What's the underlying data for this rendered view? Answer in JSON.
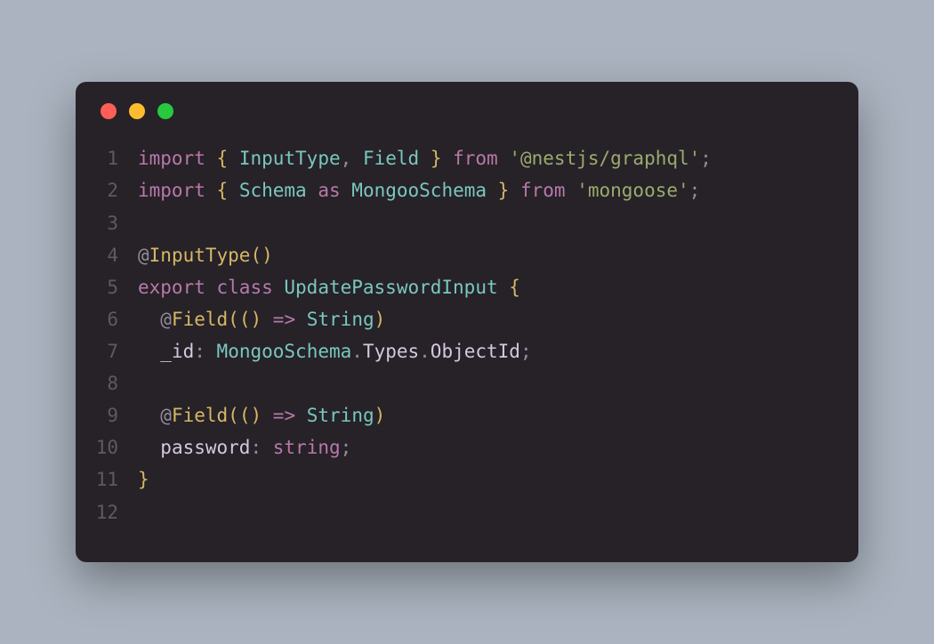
{
  "window": {
    "dots": {
      "red": "#ff5f56",
      "yellow": "#ffbd2e",
      "green": "#27c93f"
    }
  },
  "code": {
    "language": "typescript",
    "lines": [
      {
        "n": "1",
        "tokens": [
          {
            "t": "import",
            "c": "kw"
          },
          {
            "t": " ",
            "c": ""
          },
          {
            "t": "{",
            "c": "br"
          },
          {
            "t": " ",
            "c": ""
          },
          {
            "t": "InputType",
            "c": "id"
          },
          {
            "t": ",",
            "c": "punct"
          },
          {
            "t": " ",
            "c": ""
          },
          {
            "t": "Field",
            "c": "id"
          },
          {
            "t": " ",
            "c": ""
          },
          {
            "t": "}",
            "c": "br"
          },
          {
            "t": " ",
            "c": ""
          },
          {
            "t": "from",
            "c": "kw"
          },
          {
            "t": " ",
            "c": ""
          },
          {
            "t": "'@nestjs/graphql'",
            "c": "str"
          },
          {
            "t": ";",
            "c": "punct"
          }
        ]
      },
      {
        "n": "2",
        "tokens": [
          {
            "t": "import",
            "c": "kw"
          },
          {
            "t": " ",
            "c": ""
          },
          {
            "t": "{",
            "c": "br"
          },
          {
            "t": " ",
            "c": ""
          },
          {
            "t": "Schema",
            "c": "id"
          },
          {
            "t": " ",
            "c": ""
          },
          {
            "t": "as",
            "c": "kw"
          },
          {
            "t": " ",
            "c": ""
          },
          {
            "t": "MongooSchema",
            "c": "id"
          },
          {
            "t": " ",
            "c": ""
          },
          {
            "t": "}",
            "c": "br"
          },
          {
            "t": " ",
            "c": ""
          },
          {
            "t": "from",
            "c": "kw"
          },
          {
            "t": " ",
            "c": ""
          },
          {
            "t": "'mongoose'",
            "c": "str"
          },
          {
            "t": ";",
            "c": "punct"
          }
        ]
      },
      {
        "n": "3",
        "tokens": []
      },
      {
        "n": "4",
        "tokens": [
          {
            "t": "@",
            "c": "punct"
          },
          {
            "t": "InputType",
            "c": "dec"
          },
          {
            "t": "(",
            "c": "br"
          },
          {
            "t": ")",
            "c": "br"
          }
        ]
      },
      {
        "n": "5",
        "tokens": [
          {
            "t": "export",
            "c": "kw"
          },
          {
            "t": " ",
            "c": ""
          },
          {
            "t": "class",
            "c": "kw"
          },
          {
            "t": " ",
            "c": ""
          },
          {
            "t": "UpdatePasswordInput",
            "c": "id"
          },
          {
            "t": " ",
            "c": ""
          },
          {
            "t": "{",
            "c": "br"
          }
        ]
      },
      {
        "n": "6",
        "tokens": [
          {
            "t": "  ",
            "c": ""
          },
          {
            "t": "@",
            "c": "punct"
          },
          {
            "t": "Field",
            "c": "dec"
          },
          {
            "t": "(",
            "c": "br"
          },
          {
            "t": "(",
            "c": "br"
          },
          {
            "t": ")",
            "c": "br"
          },
          {
            "t": " ",
            "c": ""
          },
          {
            "t": "=>",
            "c": "arrow"
          },
          {
            "t": " ",
            "c": ""
          },
          {
            "t": "String",
            "c": "id"
          },
          {
            "t": ")",
            "c": "br"
          }
        ]
      },
      {
        "n": "7",
        "tokens": [
          {
            "t": "  ",
            "c": ""
          },
          {
            "t": "_id",
            "c": "prop"
          },
          {
            "t": ":",
            "c": "punct"
          },
          {
            "t": " ",
            "c": ""
          },
          {
            "t": "MongooSchema",
            "c": "id"
          },
          {
            "t": ".",
            "c": "punct"
          },
          {
            "t": "Types",
            "c": "prop"
          },
          {
            "t": ".",
            "c": "punct"
          },
          {
            "t": "ObjectId",
            "c": "prop"
          },
          {
            "t": ";",
            "c": "punct"
          }
        ]
      },
      {
        "n": "8",
        "tokens": []
      },
      {
        "n": "9",
        "tokens": [
          {
            "t": "  ",
            "c": ""
          },
          {
            "t": "@",
            "c": "punct"
          },
          {
            "t": "Field",
            "c": "dec"
          },
          {
            "t": "(",
            "c": "br"
          },
          {
            "t": "(",
            "c": "br"
          },
          {
            "t": ")",
            "c": "br"
          },
          {
            "t": " ",
            "c": ""
          },
          {
            "t": "=>",
            "c": "arrow"
          },
          {
            "t": " ",
            "c": ""
          },
          {
            "t": "String",
            "c": "id"
          },
          {
            "t": ")",
            "c": "br"
          }
        ]
      },
      {
        "n": "10",
        "tokens": [
          {
            "t": "  ",
            "c": ""
          },
          {
            "t": "password",
            "c": "prop"
          },
          {
            "t": ":",
            "c": "punct"
          },
          {
            "t": " ",
            "c": ""
          },
          {
            "t": "string",
            "c": "type"
          },
          {
            "t": ";",
            "c": "punct"
          }
        ]
      },
      {
        "n": "11",
        "tokens": [
          {
            "t": "}",
            "c": "br"
          }
        ]
      },
      {
        "n": "12",
        "tokens": []
      }
    ]
  }
}
